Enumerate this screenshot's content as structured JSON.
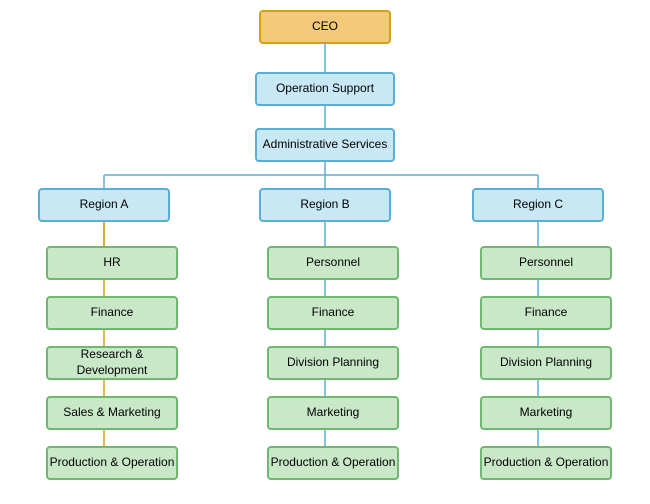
{
  "nodes": {
    "ceo": "CEO",
    "op_support": "Operation Support",
    "admin_services": "Administrative Services",
    "region_a": "Region A",
    "region_b": "Region B",
    "region_c": "Region C",
    "a_hr": "HR",
    "a_finance": "Finance",
    "a_rd": "Research & Development",
    "a_sm": "Sales & Marketing",
    "a_po": "Production & Operation",
    "b_personnel": "Personnel",
    "b_finance": "Finance",
    "b_dp": "Division Planning",
    "b_marketing": "Marketing",
    "b_po": "Production & Operation",
    "c_personnel": "Personnel",
    "c_finance": "Finance",
    "c_dp": "Division Planning",
    "c_marketing": "Marketing",
    "c_po": "Production & Operation"
  }
}
